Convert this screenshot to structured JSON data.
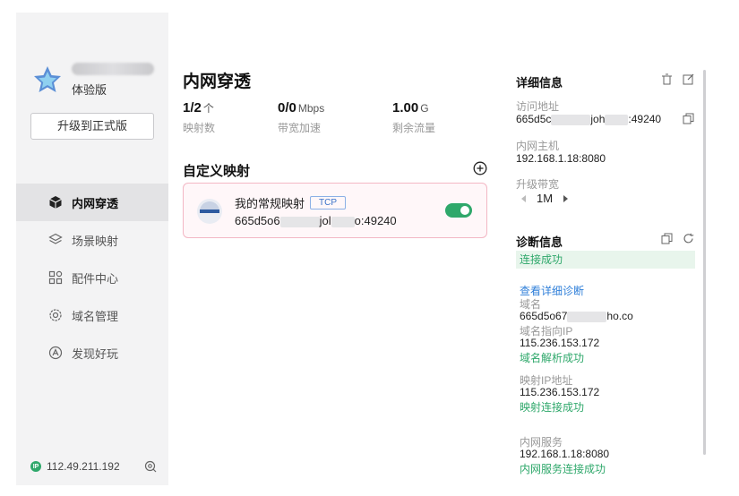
{
  "user": {
    "level": "体验版",
    "upgrade_label": "升级到正式版"
  },
  "nav": {
    "items": [
      {
        "label": "内网穿透"
      },
      {
        "label": "场景映射"
      },
      {
        "label": "配件中心"
      },
      {
        "label": "域名管理"
      },
      {
        "label": "发现好玩"
      }
    ]
  },
  "footer": {
    "ip": "112.49.211.192",
    "ip_badge": "IP"
  },
  "main": {
    "title": "内网穿透",
    "stats": [
      {
        "value": "1/2",
        "unit": "个",
        "label": "映射数"
      },
      {
        "value": "0/0",
        "unit": "Mbps",
        "label": "带宽加速"
      },
      {
        "value": "1.00",
        "unit": "G",
        "label": "剩余流量"
      }
    ],
    "section_title": "自定义映射",
    "mapping": {
      "name": "我的常规映射",
      "protocol": "TCP",
      "addr_part1": "665d5o6",
      "addr_part2": "jol",
      "addr_part3": "o:49240",
      "enabled": true
    }
  },
  "detail": {
    "title": "详细信息",
    "access_label": "访问地址",
    "access_part1": "665d5c",
    "access_part2": "joh",
    "access_part3": ":49240",
    "host_label": "内网主机",
    "host_value": "192.168.1.18:8080",
    "bw_label": "升级带宽",
    "bw_value": "1M",
    "diag_title": "诊断信息",
    "diag_status": "连接成功",
    "diag_link": "查看详细诊断",
    "domain_label": "域名",
    "domain_part1": "665d5o67",
    "domain_part2": "ho.co",
    "domain_ip_label": "域名指向IP",
    "domain_ip": "115.236.153.172",
    "domain_ok": "域名解析成功",
    "map_ip_label": "映射IP地址",
    "map_ip": "115.236.153.172",
    "map_ok": "映射连接成功",
    "svc_label": "内网服务",
    "svc_value": "192.168.1.18:8080",
    "svc_ok": "内网服务连接成功"
  },
  "colors": {
    "accent": "#2fa86b",
    "link": "#2f7fd9",
    "card_border": "#f3b7c4"
  }
}
